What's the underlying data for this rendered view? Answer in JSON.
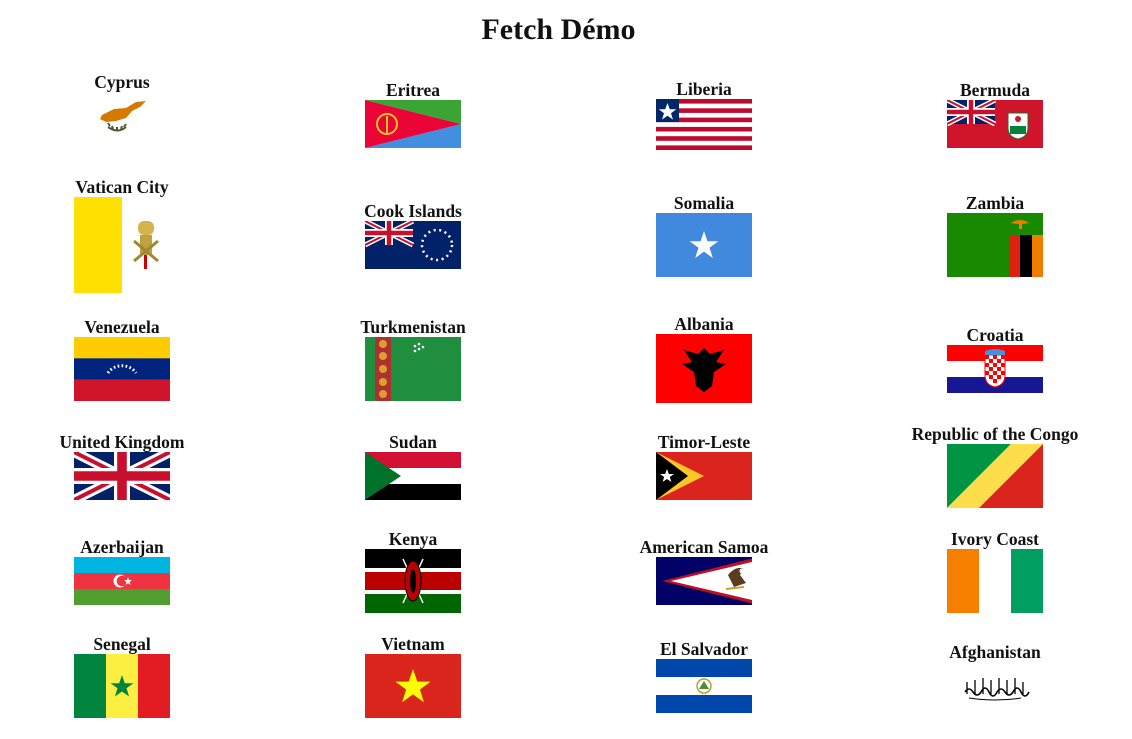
{
  "page": {
    "title": "Fetch Démo"
  },
  "flags": [
    {
      "name": "Cyprus"
    },
    {
      "name": "Eritrea"
    },
    {
      "name": "Liberia"
    },
    {
      "name": "Bermuda"
    },
    {
      "name": "Vatican City"
    },
    {
      "name": "Cook Islands"
    },
    {
      "name": "Somalia"
    },
    {
      "name": "Zambia"
    },
    {
      "name": "Venezuela"
    },
    {
      "name": "Turkmenistan"
    },
    {
      "name": "Albania"
    },
    {
      "name": "Croatia"
    },
    {
      "name": "United Kingdom"
    },
    {
      "name": "Sudan"
    },
    {
      "name": "Timor-Leste"
    },
    {
      "name": "Republic of the Congo"
    },
    {
      "name": "Azerbaijan"
    },
    {
      "name": "Kenya"
    },
    {
      "name": "American Samoa"
    },
    {
      "name": "Ivory Coast"
    },
    {
      "name": "Senegal"
    },
    {
      "name": "Vietnam"
    },
    {
      "name": "El Salvador"
    },
    {
      "name": "Afghanistan"
    }
  ]
}
